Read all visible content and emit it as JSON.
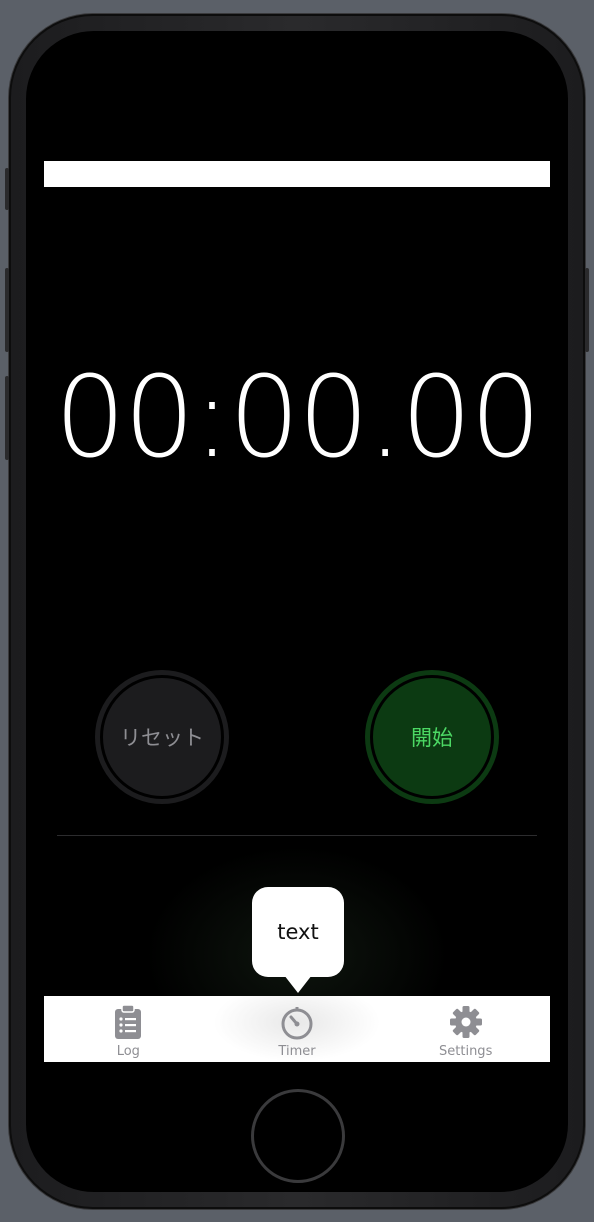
{
  "timer": {
    "display": "00:00.00"
  },
  "controls": {
    "reset_label": "リセット",
    "start_label": "開始"
  },
  "tooltip": {
    "text": "text"
  },
  "tab_bar": {
    "items": [
      {
        "label": "Log",
        "icon": "clipboard-icon"
      },
      {
        "label": "Timer",
        "icon": "stopwatch-icon"
      },
      {
        "label": "Settings",
        "icon": "gear-icon"
      }
    ],
    "active": "Timer"
  },
  "colors": {
    "background": "#000000",
    "start_text": "#4cd964",
    "start_bg": "#0c3a12",
    "reset_bg": "#1c1c1e",
    "tab_inactive": "#8e8e93"
  }
}
